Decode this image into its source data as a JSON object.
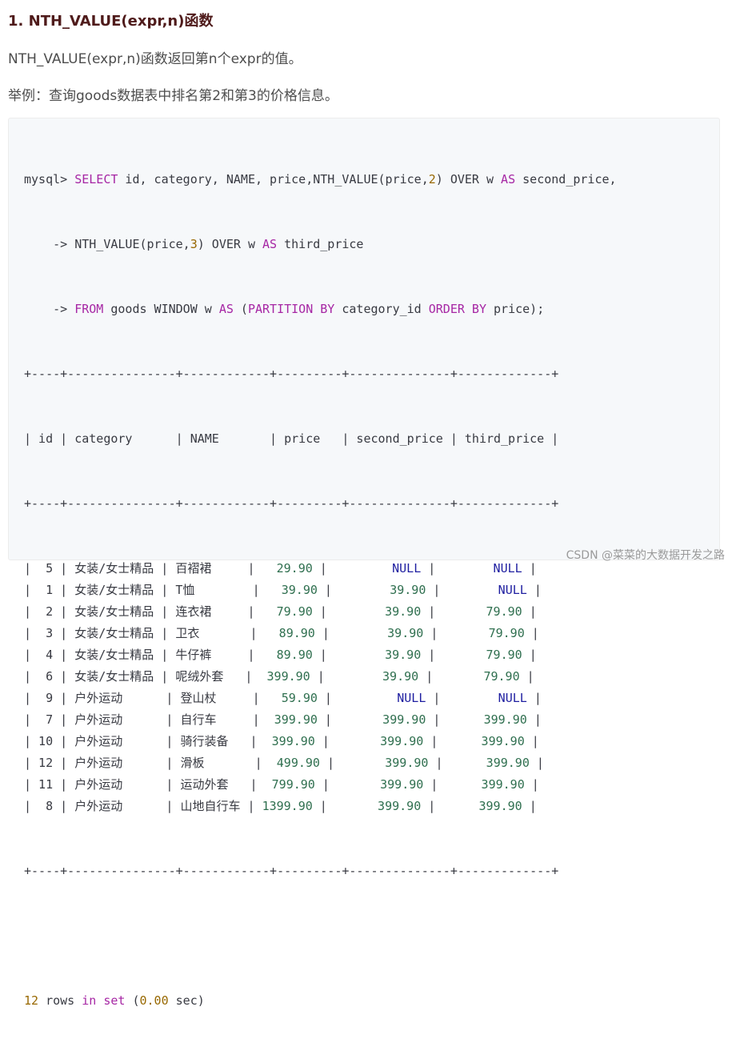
{
  "heading": "1. NTH_VALUE(expr,n)函数",
  "para1": "NTH_VALUE(expr,n)函数返回第n个expr的值。",
  "para2": "举例：查询goods数据表中排名第2和第3的价格信息。",
  "query": {
    "line1": [
      {
        "t": "mysql> ",
        "c": ""
      },
      {
        "t": "SELECT",
        "c": "kw"
      },
      {
        "t": " id, category, NAME, price,NTH_VALUE(price,",
        "c": ""
      },
      {
        "t": "2",
        "c": "num"
      },
      {
        "t": ") OVER w ",
        "c": ""
      },
      {
        "t": "AS",
        "c": "kw"
      },
      {
        "t": " second_price,",
        "c": ""
      }
    ],
    "line2": [
      {
        "t": "    -> NTH_VALUE(price,",
        "c": ""
      },
      {
        "t": "3",
        "c": "num"
      },
      {
        "t": ") OVER w ",
        "c": ""
      },
      {
        "t": "AS",
        "c": "kw"
      },
      {
        "t": " third_price",
        "c": ""
      }
    ],
    "line3": [
      {
        "t": "    -> ",
        "c": ""
      },
      {
        "t": "FROM",
        "c": "kw"
      },
      {
        "t": " goods WINDOW w ",
        "c": ""
      },
      {
        "t": "AS",
        "c": "kw"
      },
      {
        "t": " (",
        "c": ""
      },
      {
        "t": "PARTITION BY",
        "c": "kw"
      },
      {
        "t": " category_id ",
        "c": ""
      },
      {
        "t": "ORDER BY",
        "c": "kw"
      },
      {
        "t": " price);",
        "c": ""
      }
    ]
  },
  "table": {
    "border": "+----+---------------+------------+---------+--------------+-------------+",
    "header": "| id | category      | NAME       | price   | second_price | third_price |",
    "rows": [
      {
        "id": "5",
        "category": "女装/女士精品",
        "name": "百褶裙",
        "price": "29.90",
        "second": "NULL",
        "third": "NULL"
      },
      {
        "id": "1",
        "category": "女装/女士精品",
        "name": "T恤",
        "price": "39.90",
        "second": "39.90",
        "third": "NULL"
      },
      {
        "id": "2",
        "category": "女装/女士精品",
        "name": "连衣裙",
        "price": "79.90",
        "second": "39.90",
        "third": "79.90"
      },
      {
        "id": "3",
        "category": "女装/女士精品",
        "name": "卫衣",
        "price": "89.90",
        "second": "39.90",
        "third": "79.90"
      },
      {
        "id": "4",
        "category": "女装/女士精品",
        "name": "牛仔裤",
        "price": "89.90",
        "second": "39.90",
        "third": "79.90"
      },
      {
        "id": "6",
        "category": "女装/女士精品",
        "name": "呢绒外套",
        "price": "399.90",
        "second": "39.90",
        "third": "79.90"
      },
      {
        "id": "9",
        "category": "户外运动",
        "name": "登山杖",
        "price": "59.90",
        "second": "NULL",
        "third": "NULL"
      },
      {
        "id": "7",
        "category": "户外运动",
        "name": "自行车",
        "price": "399.90",
        "second": "399.90",
        "third": "399.90"
      },
      {
        "id": "10",
        "category": "户外运动",
        "name": "骑行装备",
        "price": "399.90",
        "second": "399.90",
        "third": "399.90"
      },
      {
        "id": "12",
        "category": "户外运动",
        "name": "滑板",
        "price": "499.90",
        "second": "399.90",
        "third": "399.90"
      },
      {
        "id": "11",
        "category": "户外运动",
        "name": "运动外套",
        "price": "799.90",
        "second": "399.90",
        "third": "399.90"
      },
      {
        "id": "8",
        "category": "户外运动",
        "name": "山地自行车",
        "price": "1399.90",
        "second": "399.90",
        "third": "399.90"
      }
    ]
  },
  "footer": [
    {
      "t": "12",
      "c": "num"
    },
    {
      "t": " rows ",
      "c": ""
    },
    {
      "t": "in",
      "c": "kw"
    },
    {
      "t": " ",
      "c": ""
    },
    {
      "t": "set",
      "c": "kw"
    },
    {
      "t": " (",
      "c": ""
    },
    {
      "t": "0.00",
      "c": "num"
    },
    {
      "t": " sec)",
      "c": ""
    }
  ],
  "watermark": "CSDN @菜菜的大数据开发之路"
}
